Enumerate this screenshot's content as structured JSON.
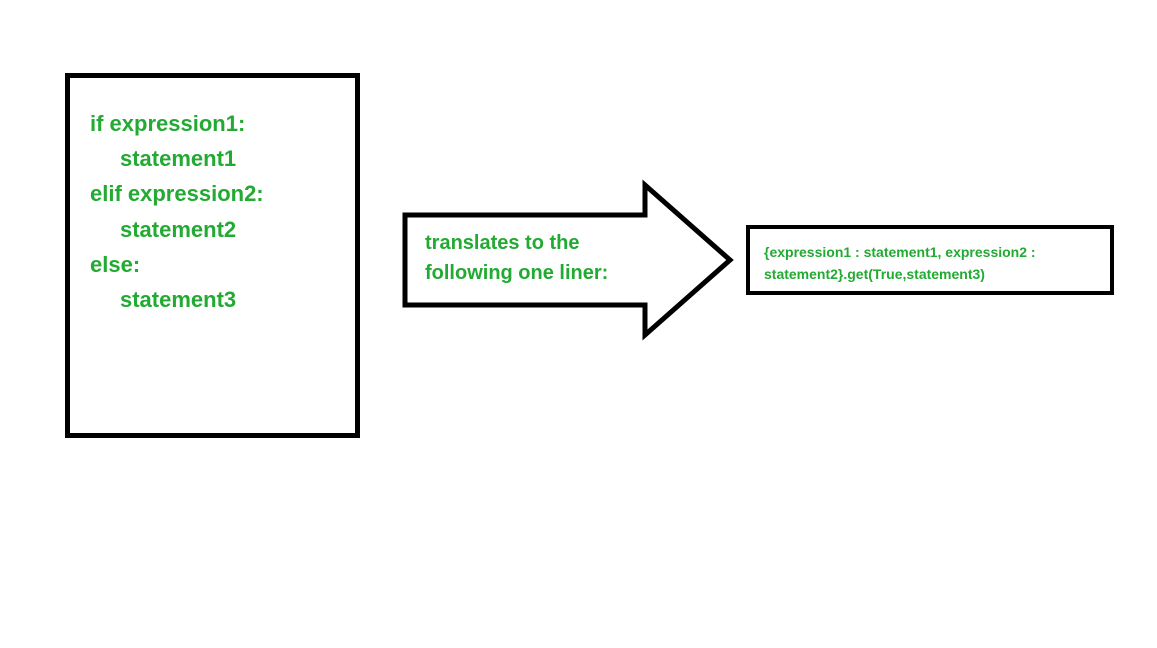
{
  "leftBox": {
    "line1": "if expression1:",
    "line2": "statement1",
    "line3": "elif expression2:",
    "line4": "statement2",
    "line5": "else:",
    "line6": "statement3"
  },
  "arrow": {
    "textLine1": "translates to the",
    "textLine2": "following one liner:"
  },
  "rightBox": {
    "line1": "{expression1 : statement1, expression2 :",
    "line2": "statement2}.get(True,statement3)"
  }
}
